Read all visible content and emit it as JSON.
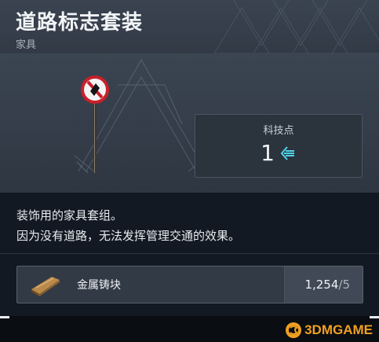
{
  "header": {
    "title": "道路标志套装",
    "category": "家具"
  },
  "tech": {
    "label": "科技点",
    "value": "1",
    "icon": "tech-point-icon"
  },
  "description": {
    "line1": "装饰用的家具套组。",
    "line2": "因为没有道路，无法发挥管理交通的效果。"
  },
  "resources": [
    {
      "icon": "metal-ingot-icon",
      "name": "金属铸块",
      "owned": "1,254",
      "required": "/5"
    }
  ],
  "watermark": {
    "text": "3DMGAME",
    "logo": "3dm-logo"
  },
  "colors": {
    "accent_cyan": "#4fd4e8",
    "sign_red": "#c8202a",
    "watermark_orange": "#f0a020"
  }
}
